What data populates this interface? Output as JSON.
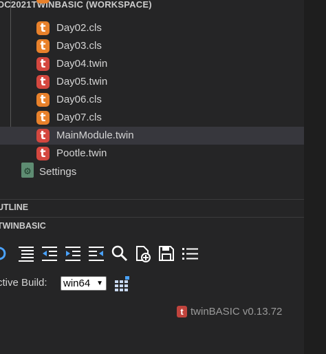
{
  "explorer": {
    "workspace_title": "OC2021TWINBASIC (WORKSPACE)",
    "files": [
      {
        "name": "Day02.cls",
        "type": "cls"
      },
      {
        "name": "Day03.cls",
        "type": "cls"
      },
      {
        "name": "Day04.twin",
        "type": "twin"
      },
      {
        "name": "Day05.twin",
        "type": "twin"
      },
      {
        "name": "Day06.cls",
        "type": "cls"
      },
      {
        "name": "Day07.cls",
        "type": "cls"
      },
      {
        "name": "MainModule.twin",
        "type": "twin",
        "selected": true
      },
      {
        "name": "Pootle.twin",
        "type": "twin"
      }
    ],
    "settings_label": "Settings"
  },
  "outline": {
    "title": "UTLINE"
  },
  "twinbasic": {
    "title": "TWINBASIC",
    "toolbar": [
      {
        "icon": "restart-icon"
      },
      {
        "icon": "align-left-icon"
      },
      {
        "icon": "outdent-icon"
      },
      {
        "icon": "indent-icon"
      },
      {
        "icon": "unindent-icon"
      },
      {
        "icon": "search-icon"
      },
      {
        "icon": "new-file-icon"
      },
      {
        "icon": "save-icon"
      },
      {
        "icon": "list-icon"
      }
    ],
    "active_build_label": "ctive Build:",
    "active_build_value": "win64",
    "version_text": "twinBASIC v0.13.72"
  },
  "colors": {
    "background": "#252526",
    "selection": "#37373d",
    "cls_icon": "#e8812b",
    "twin_icon": "#d4473f",
    "settings_icon": "#5e8c72"
  }
}
